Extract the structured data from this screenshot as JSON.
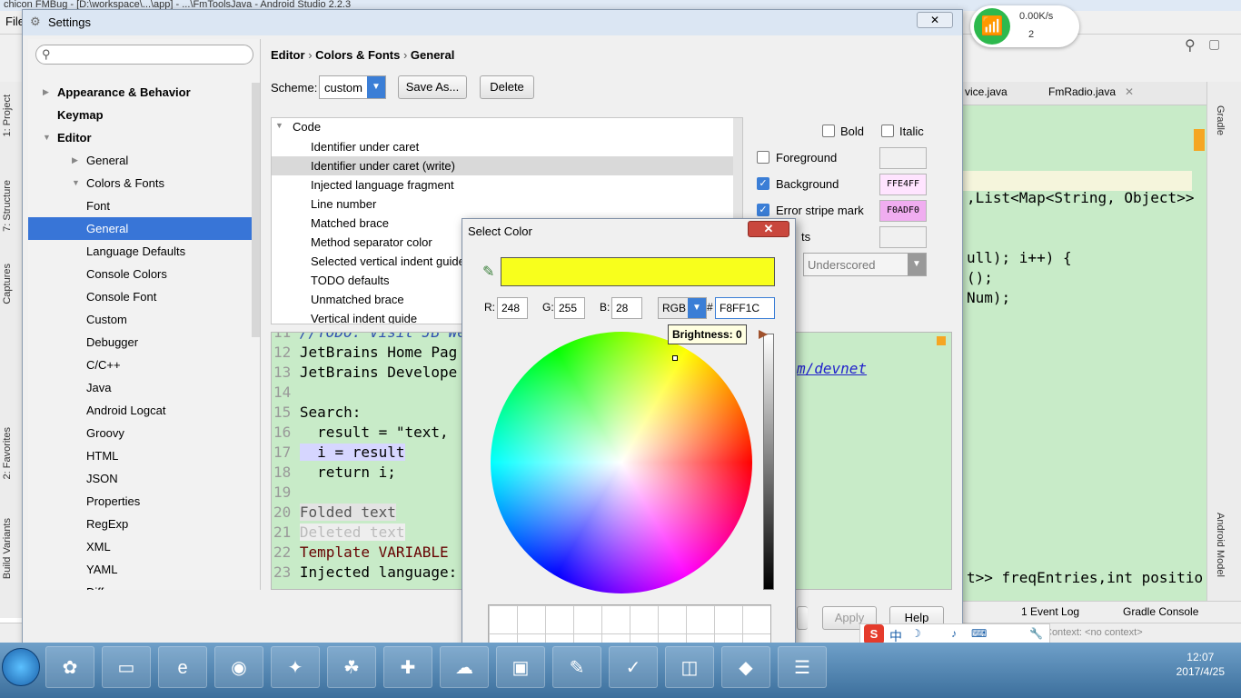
{
  "ide": {
    "title_fragment": "chicon FMBug - [D:\\workspace\\...\\app] - ...\\FmToolsJava - Android Studio 2.2.3",
    "menu_file": "File",
    "vertical_left_tabs": [
      "1: Project",
      "7: Structure",
      "Captures",
      "2: Favorites",
      "Build Variants"
    ],
    "vertical_right_tabs": [
      "Gradle",
      "Android Model"
    ],
    "editor_tabs": [
      "vice.java",
      "FmRadio.java"
    ],
    "code_lines": [
      ",List<Map<String, Object>>",
      "ull); i++) {",
      "();",
      "Num);",
      "t>> freqEntries,int positio"
    ],
    "bottom_tools": [
      "1 Event Log",
      "Gradle Console"
    ],
    "status_context": "Context: <no context>"
  },
  "net_widget": {
    "speed": "0.00K/s",
    "count": "2"
  },
  "settings": {
    "title": "Settings",
    "close_label": "✕",
    "search_placeholder": "",
    "tree": [
      {
        "label": "Appearance & Behavior",
        "level": 0,
        "bold": true,
        "arrow": "▶"
      },
      {
        "label": "Keymap",
        "level": 0,
        "bold": true,
        "arrow": ""
      },
      {
        "label": "Editor",
        "level": 0,
        "bold": true,
        "arrow": "▼"
      },
      {
        "label": "General",
        "level": 1,
        "bold": false,
        "arrow": "▶"
      },
      {
        "label": "Colors & Fonts",
        "level": 1,
        "bold": false,
        "arrow": "▼"
      },
      {
        "label": "Font",
        "level": 2,
        "bold": false,
        "arrow": ""
      },
      {
        "label": "General",
        "level": 2,
        "bold": false,
        "arrow": "",
        "selected": true
      },
      {
        "label": "Language Defaults",
        "level": 2,
        "bold": false,
        "arrow": ""
      },
      {
        "label": "Console Colors",
        "level": 2,
        "bold": false,
        "arrow": ""
      },
      {
        "label": "Console Font",
        "level": 2,
        "bold": false,
        "arrow": ""
      },
      {
        "label": "Custom",
        "level": 2,
        "bold": false,
        "arrow": ""
      },
      {
        "label": "Debugger",
        "level": 2,
        "bold": false,
        "arrow": ""
      },
      {
        "label": "C/C++",
        "level": 2,
        "bold": false,
        "arrow": ""
      },
      {
        "label": "Java",
        "level": 2,
        "bold": false,
        "arrow": ""
      },
      {
        "label": "Android Logcat",
        "level": 2,
        "bold": false,
        "arrow": ""
      },
      {
        "label": "Groovy",
        "level": 2,
        "bold": false,
        "arrow": ""
      },
      {
        "label": "HTML",
        "level": 2,
        "bold": false,
        "arrow": ""
      },
      {
        "label": "JSON",
        "level": 2,
        "bold": false,
        "arrow": ""
      },
      {
        "label": "Properties",
        "level": 2,
        "bold": false,
        "arrow": ""
      },
      {
        "label": "RegExp",
        "level": 2,
        "bold": false,
        "arrow": ""
      },
      {
        "label": "XML",
        "level": 2,
        "bold": false,
        "arrow": ""
      },
      {
        "label": "YAML",
        "level": 2,
        "bold": false,
        "arrow": ""
      },
      {
        "label": "Diff",
        "level": 2,
        "bold": false,
        "arrow": ""
      }
    ],
    "breadcrumb": [
      "Editor",
      "Colors & Fonts",
      "General"
    ],
    "breadcrumb_sep": "›",
    "scheme_label": "Scheme:",
    "scheme_value": "custom",
    "save_as_label": "Save As...",
    "delete_label": "Delete",
    "attr_group": "Code",
    "attributes": [
      "Identifier under caret",
      "Identifier under caret (write)",
      "Injected language fragment",
      "Line number",
      "Matched brace",
      "Method separator color",
      "Selected vertical indent guide",
      "TODO defaults",
      "Unmatched brace",
      "Vertical indent guide"
    ],
    "selected_attribute_index": 1,
    "bold_label": "Bold",
    "italic_label": "Italic",
    "foreground_label": "Foreground",
    "background_label": "Background",
    "background_value": "FFE4FF",
    "background_color": "#FFE4FF",
    "error_stripe_label": "Error stripe mark",
    "error_stripe_value": "F0ADF0",
    "error_stripe_color": "#F0ADF0",
    "effects_label_fragment": "ts",
    "effects_value": "Underscored",
    "apply_label": "Apply",
    "help_label": "Help",
    "preview": [
      {
        "num": "11",
        "text": "//TODO: Visit JB Web"
      },
      {
        "num": "12",
        "text": "JetBrains Home Pag"
      },
      {
        "num": "13",
        "text": "JetBrains Develope"
      },
      {
        "num": "14",
        "text": ""
      },
      {
        "num": "15",
        "text": "Search:"
      },
      {
        "num": "16",
        "text": "  result = \"text, "
      },
      {
        "num": "17",
        "text": "  i = result"
      },
      {
        "num": "18",
        "text": "  return i;"
      },
      {
        "num": "19",
        "text": ""
      },
      {
        "num": "20",
        "text": "Folded text"
      },
      {
        "num": "21",
        "text": "Deleted text"
      },
      {
        "num": "22",
        "text": "Template VARIABLE"
      },
      {
        "num": "23",
        "text": "Injected language:"
      }
    ],
    "preview_link_fragment": "m/devnet"
  },
  "color_dialog": {
    "title": "Select Color",
    "close_label": "✕",
    "swatch_color": "#F8FF1C",
    "r_label": "R:",
    "r_value": "248",
    "g_label": "G:",
    "g_value": "255",
    "b_label": "B:",
    "b_value": "28",
    "mode_value": "RGB",
    "hash_label": "#",
    "hex_value": "F8FF1C",
    "brightness_tooltip": "Brightness: 0"
  },
  "taskbar": {
    "time": "12:07",
    "date": "2017/4/25"
  },
  "ime": {
    "label": "中"
  }
}
